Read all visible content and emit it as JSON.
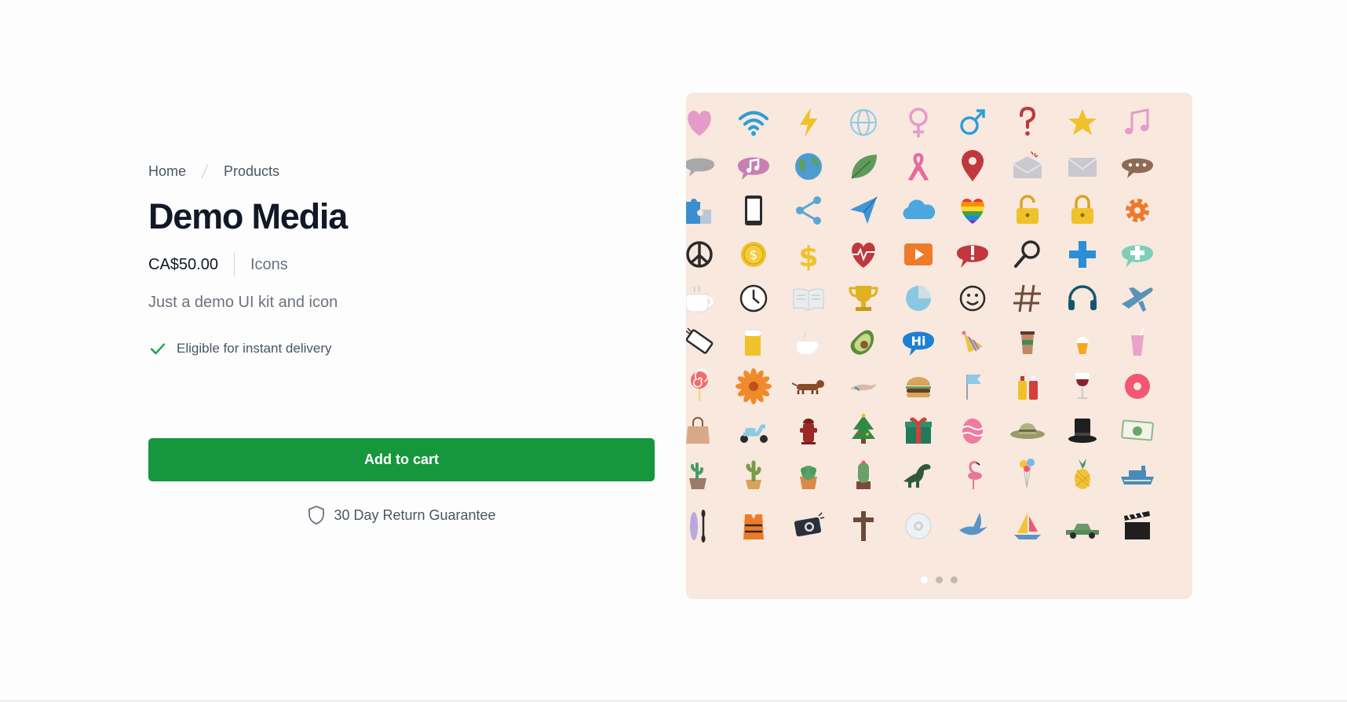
{
  "breadcrumb": {
    "home": "Home",
    "products": "Products"
  },
  "product": {
    "title": "Demo Media",
    "price": "CA$50.00",
    "category": "Icons",
    "description": "Just a demo UI kit and icon",
    "delivery_note": "Eligible for instant delivery",
    "add_to_cart_label": "Add to cart",
    "guarantee": "30 Day Return Guarantee"
  },
  "gallery": {
    "background": "#f8e8de",
    "icons": [
      "heart-icon",
      "wifi-icon",
      "lightning-icon",
      "globe-icon",
      "female-symbol-icon",
      "male-symbol-icon",
      "question-mark-icon",
      "star-icon",
      "music-note-icon",
      "speech-bubble-icon",
      "music-bubble-icon",
      "earth-icon",
      "leaf-icon",
      "ribbon-icon",
      "map-pin-icon",
      "open-envelope-icon",
      "envelope-icon",
      "chat-dots-icon",
      "puzzle-icon",
      "tablet-icon",
      "share-icon",
      "paper-plane-icon",
      "cloud-icon",
      "rainbow-heart-icon",
      "padlock-open-icon",
      "padlock-icon",
      "gear-icon",
      "peace-icon",
      "coin-icon",
      "dollar-icon",
      "heartbeat-icon",
      "play-button-icon",
      "alert-bubble-icon",
      "magnifier-icon",
      "plus-icon",
      "plus-bubble-icon",
      "coffee-cup-icon",
      "clock-icon",
      "book-icon",
      "trophy-icon",
      "pie-chart-icon",
      "smiley-icon",
      "hashtag-icon",
      "headphones-icon",
      "airplane-icon",
      "phone-icon",
      "beer-icon",
      "tea-cup-icon",
      "avocado-icon",
      "hi-bubble-icon",
      "party-hat-icon",
      "coffee-to-go-icon",
      "ice-cream-cup-icon",
      "milkshake-icon",
      "lollipop-icon",
      "flower-icon",
      "dachshund-icon",
      "bird-icon",
      "burger-icon",
      "flag-icon",
      "condiments-icon",
      "wine-glass-icon",
      "donut-icon",
      "shopping-bag-icon",
      "scooter-icon",
      "hydrant-icon",
      "christmas-tree-icon",
      "gift-icon",
      "easter-egg-icon",
      "sun-hat-icon",
      "top-hat-icon",
      "banknote-icon",
      "cactus-pot-icon",
      "cactus-icon",
      "succulent-icon",
      "potted-cactus-icon",
      "dinosaur-icon",
      "flamingo-icon",
      "balloons-icon",
      "pineapple-icon",
      "ship-icon",
      "kayak-icon",
      "life-vest-icon",
      "camera-icon",
      "cross-icon",
      "disc-icon",
      "dove-icon",
      "sailboat-icon",
      "car-icon",
      "clapperboard-icon"
    ]
  },
  "carousel": {
    "count": 3,
    "active": 0
  },
  "colors": {
    "cta": "#16973e",
    "check": "#16a34a",
    "text": "#111827",
    "muted": "#6b7280"
  }
}
